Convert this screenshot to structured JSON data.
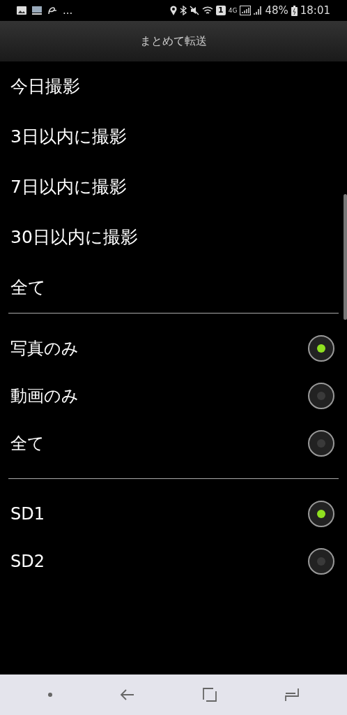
{
  "status_bar": {
    "more": "...",
    "sim": "1",
    "network": "4G",
    "battery": "48%",
    "time": "18:01"
  },
  "title": "まとめて転送",
  "periods": [
    {
      "label": "今日撮影"
    },
    {
      "label": "3日以内に撮影"
    },
    {
      "label": "7日以内に撮影"
    },
    {
      "label": "30日以内に撮影"
    },
    {
      "label": "全て"
    }
  ],
  "media_types": [
    {
      "label": "写真のみ",
      "selected": true
    },
    {
      "label": "動画のみ",
      "selected": false
    },
    {
      "label": "全て",
      "selected": false
    }
  ],
  "cards": [
    {
      "label": "SD1",
      "selected": true
    },
    {
      "label": "SD2",
      "selected": false
    }
  ]
}
